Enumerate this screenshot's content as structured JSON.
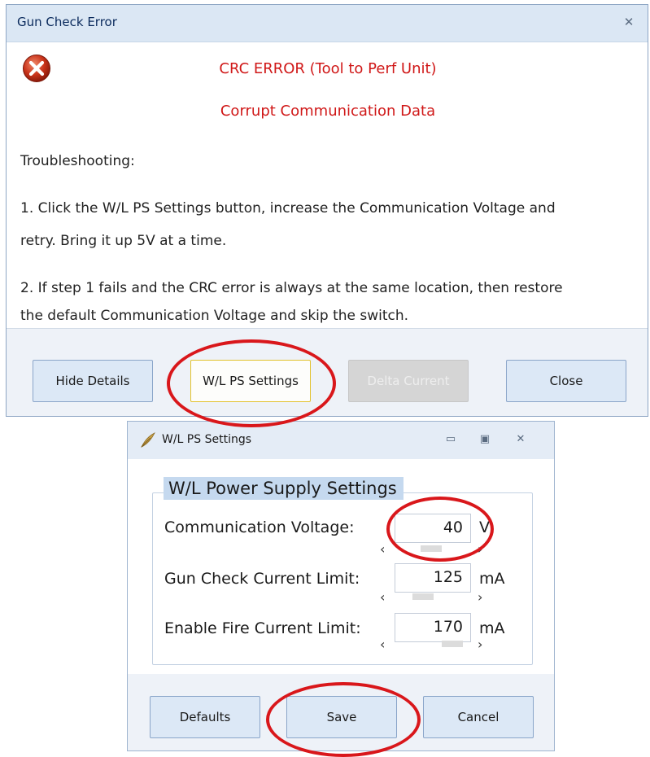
{
  "error_dialog": {
    "title": "Gun Check Error",
    "close_glyph": "✕",
    "icon": "error-icon",
    "heading": "CRC ERROR (Tool to Perf Unit)",
    "subheading": "Corrupt Communication Data",
    "troubleshooting_label": "Troubleshooting:",
    "step1_line1": "1. Click the W/L PS Settings button, increase the Communication Voltage and",
    "step1_line2": "retry. Bring it up 5V at a time.",
    "step2_line1": "2. If step 1 fails and the CRC error is always at the same location, then restore",
    "step2_line2": "the default Communication Voltage and skip the switch.",
    "buttons": {
      "hide_details": "Hide Details",
      "wl_ps_settings": "W/L PS Settings",
      "delta_current": "Delta Current",
      "close": "Close"
    }
  },
  "settings_dialog": {
    "title": "W/L PS Settings",
    "group_title": "W/L Power Supply Settings",
    "fields": {
      "communication_voltage": {
        "label": "Communication Voltage:",
        "value": "40",
        "unit": "V"
      },
      "gun_check_current_limit": {
        "label": "Gun Check Current Limit:",
        "value": "125",
        "unit": "mA"
      },
      "enable_fire_current_limit": {
        "label": "Enable Fire Current Limit:",
        "value": "170",
        "unit": "mA"
      }
    },
    "buttons": {
      "defaults": "Defaults",
      "save": "Save",
      "cancel": "Cancel"
    }
  },
  "colors": {
    "error_text": "#d01818",
    "annotation_circle": "#d9171b",
    "title_bar": "#dbe7f4",
    "button_face": "#dce8f6"
  }
}
